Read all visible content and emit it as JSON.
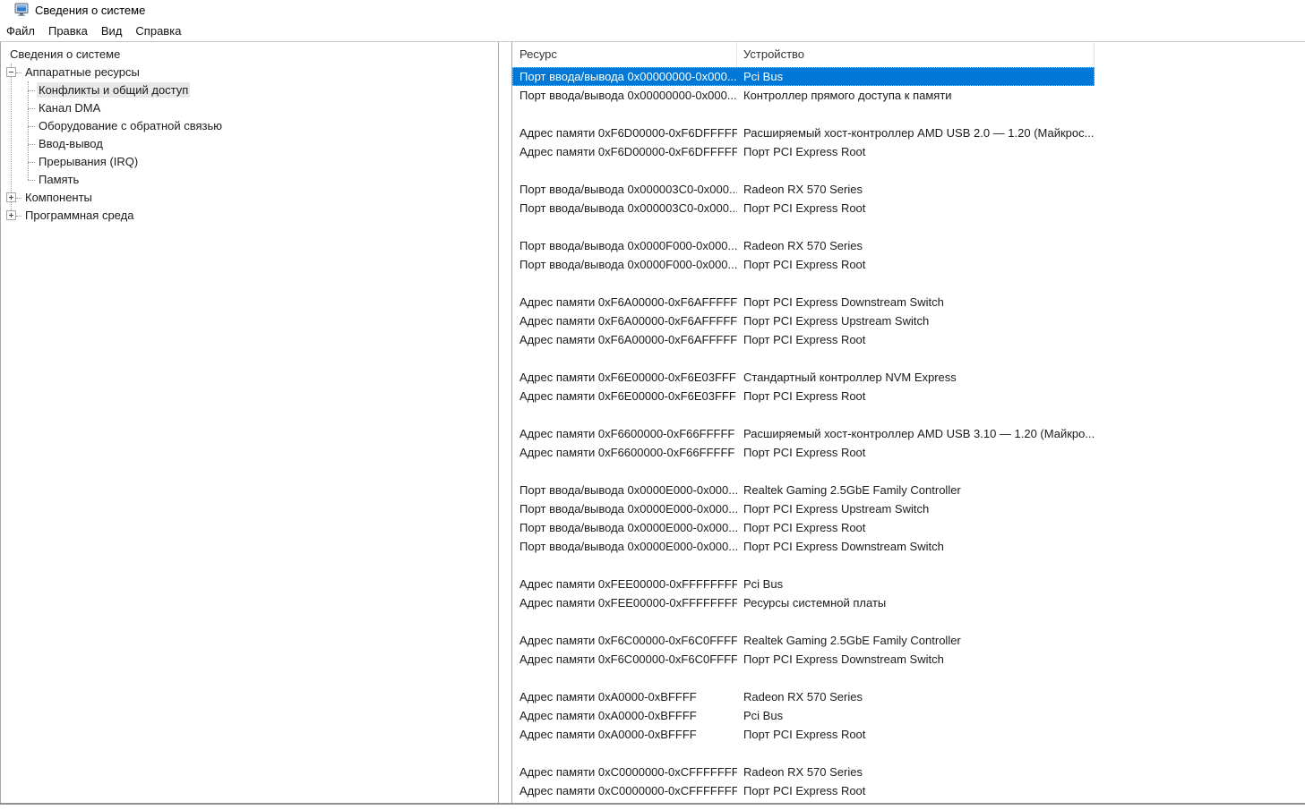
{
  "window": {
    "title": "Сведения о системе",
    "icon": "system-info-icon"
  },
  "menu": {
    "items": [
      {
        "id": "file",
        "label": "Файл"
      },
      {
        "id": "edit",
        "label": "Правка"
      },
      {
        "id": "view",
        "label": "Вид"
      },
      {
        "id": "help",
        "label": "Справка"
      }
    ]
  },
  "tree": {
    "items": [
      {
        "id": "system-summary",
        "label": "Сведения о системе",
        "level": 0,
        "expander": "none",
        "selected": false
      },
      {
        "id": "hardware-resources",
        "label": "Аппаратные ресурсы",
        "level": 1,
        "expander": "minus",
        "selected": false
      },
      {
        "id": "conflicts-sharing",
        "label": "Конфликты и общий доступ",
        "level": 2,
        "expander": "none",
        "selected": true
      },
      {
        "id": "dma-channel",
        "label": "Канал DMA",
        "level": 2,
        "expander": "none",
        "selected": false
      },
      {
        "id": "forced-hardware",
        "label": "Оборудование с обратной связью",
        "level": 2,
        "expander": "none",
        "selected": false
      },
      {
        "id": "input-output",
        "label": "Ввод-вывод",
        "level": 2,
        "expander": "none",
        "selected": false
      },
      {
        "id": "irq",
        "label": "Прерывания (IRQ)",
        "level": 2,
        "expander": "none",
        "selected": false
      },
      {
        "id": "memory",
        "label": "Память",
        "level": 2,
        "expander": "none",
        "selected": false
      },
      {
        "id": "components",
        "label": "Компоненты",
        "level": 1,
        "expander": "plus",
        "selected": false
      },
      {
        "id": "software-environment",
        "label": "Программная среда",
        "level": 1,
        "expander": "plus",
        "selected": false
      }
    ]
  },
  "table": {
    "columns": [
      {
        "id": "resource",
        "label": "Ресурс"
      },
      {
        "id": "device",
        "label": "Устройство"
      }
    ],
    "rows": [
      {
        "type": "data",
        "selected": true,
        "resource": "Порт ввода/вывода 0x00000000-0x000...",
        "device": "Pci Bus"
      },
      {
        "type": "data",
        "selected": false,
        "resource": "Порт ввода/вывода 0x00000000-0x000...",
        "device": "Контроллер прямого доступа к памяти"
      },
      {
        "type": "separator"
      },
      {
        "type": "data",
        "selected": false,
        "resource": "Адрес памяти 0xF6D00000-0xF6DFFFFF",
        "device": "Расширяемый хост-контроллер AMD USB 2.0 — 1.20 (Майкрос..."
      },
      {
        "type": "data",
        "selected": false,
        "resource": "Адрес памяти 0xF6D00000-0xF6DFFFFF",
        "device": "Порт PCI Express Root"
      },
      {
        "type": "separator"
      },
      {
        "type": "data",
        "selected": false,
        "resource": "Порт ввода/вывода 0x000003C0-0x000...",
        "device": "Radeon RX 570 Series"
      },
      {
        "type": "data",
        "selected": false,
        "resource": "Порт ввода/вывода 0x000003C0-0x000...",
        "device": "Порт PCI Express Root"
      },
      {
        "type": "separator"
      },
      {
        "type": "data",
        "selected": false,
        "resource": "Порт ввода/вывода 0x0000F000-0x000...",
        "device": "Radeon RX 570 Series"
      },
      {
        "type": "data",
        "selected": false,
        "resource": "Порт ввода/вывода 0x0000F000-0x000...",
        "device": "Порт PCI Express Root"
      },
      {
        "type": "separator"
      },
      {
        "type": "data",
        "selected": false,
        "resource": "Адрес памяти 0xF6A00000-0xF6AFFFFF",
        "device": "Порт PCI Express Downstream Switch"
      },
      {
        "type": "data",
        "selected": false,
        "resource": "Адрес памяти 0xF6A00000-0xF6AFFFFF",
        "device": "Порт PCI Express Upstream Switch"
      },
      {
        "type": "data",
        "selected": false,
        "resource": "Адрес памяти 0xF6A00000-0xF6AFFFFF",
        "device": "Порт PCI Express Root"
      },
      {
        "type": "separator"
      },
      {
        "type": "data",
        "selected": false,
        "resource": "Адрес памяти 0xF6E00000-0xF6E03FFF",
        "device": "Стандартный контроллер NVM Express"
      },
      {
        "type": "data",
        "selected": false,
        "resource": "Адрес памяти 0xF6E00000-0xF6E03FFF",
        "device": "Порт PCI Express Root"
      },
      {
        "type": "separator"
      },
      {
        "type": "data",
        "selected": false,
        "resource": "Адрес памяти 0xF6600000-0xF66FFFFF",
        "device": "Расширяемый хост-контроллер AMD USB 3.10 — 1.20 (Майкро..."
      },
      {
        "type": "data",
        "selected": false,
        "resource": "Адрес памяти 0xF6600000-0xF66FFFFF",
        "device": "Порт PCI Express Root"
      },
      {
        "type": "separator"
      },
      {
        "type": "data",
        "selected": false,
        "resource": "Порт ввода/вывода 0x0000E000-0x000...",
        "device": "Realtek Gaming 2.5GbE Family Controller"
      },
      {
        "type": "data",
        "selected": false,
        "resource": "Порт ввода/вывода 0x0000E000-0x000...",
        "device": "Порт PCI Express Upstream Switch"
      },
      {
        "type": "data",
        "selected": false,
        "resource": "Порт ввода/вывода 0x0000E000-0x000...",
        "device": "Порт PCI Express Root"
      },
      {
        "type": "data",
        "selected": false,
        "resource": "Порт ввода/вывода 0x0000E000-0x000...",
        "device": "Порт PCI Express Downstream Switch"
      },
      {
        "type": "separator"
      },
      {
        "type": "data",
        "selected": false,
        "resource": "Адрес памяти 0xFEE00000-0xFFFFFFFF",
        "device": "Pci Bus"
      },
      {
        "type": "data",
        "selected": false,
        "resource": "Адрес памяти 0xFEE00000-0xFFFFFFFF",
        "device": "Ресурсы системной платы"
      },
      {
        "type": "separator"
      },
      {
        "type": "data",
        "selected": false,
        "resource": "Адрес памяти 0xF6C00000-0xF6C0FFFF",
        "device": "Realtek Gaming 2.5GbE Family Controller"
      },
      {
        "type": "data",
        "selected": false,
        "resource": "Адрес памяти 0xF6C00000-0xF6C0FFFF",
        "device": "Порт PCI Express Downstream Switch"
      },
      {
        "type": "separator"
      },
      {
        "type": "data",
        "selected": false,
        "resource": "Адрес памяти 0xA0000-0xBFFFF",
        "device": "Radeon RX 570 Series"
      },
      {
        "type": "data",
        "selected": false,
        "resource": "Адрес памяти 0xA0000-0xBFFFF",
        "device": "Pci Bus"
      },
      {
        "type": "data",
        "selected": false,
        "resource": "Адрес памяти 0xA0000-0xBFFFF",
        "device": "Порт PCI Express Root"
      },
      {
        "type": "separator"
      },
      {
        "type": "data",
        "selected": false,
        "resource": "Адрес памяти 0xC0000000-0xCFFFFFFF",
        "device": "Radeon RX 570 Series"
      },
      {
        "type": "data",
        "selected": false,
        "resource": "Адрес памяти 0xC0000000-0xCFFFFFFF",
        "device": "Порт PCI Express Root"
      }
    ]
  },
  "colors": {
    "selection_bg": "#0078d7",
    "selection_fg": "#ffffff",
    "tree_selected_bg": "#e8e8e8",
    "pane_border": "#a6a6a6",
    "window_bottom_edge": "#8f8f8f"
  }
}
